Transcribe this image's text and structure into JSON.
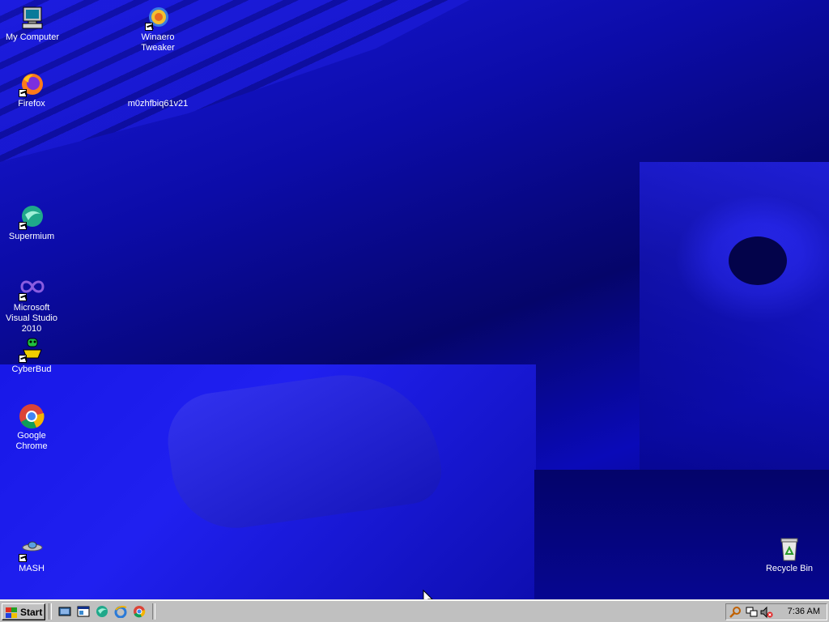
{
  "desktop": {
    "icons": [
      {
        "label": "My Computer"
      },
      {
        "label": "Winaero Tweaker"
      },
      {
        "label": "Firefox"
      },
      {
        "label": "m0zhfbiq61v21"
      },
      {
        "label": "Supermium"
      },
      {
        "label": "Microsoft Visual Studio 2010"
      },
      {
        "label": "CyberBud"
      },
      {
        "label": "Google Chrome"
      },
      {
        "label": "MASH"
      },
      {
        "label": "Recycle Bin"
      }
    ]
  },
  "taskbar": {
    "start_label": "Start",
    "quick_launch": [
      "show-desktop-icon",
      "explorer-icon",
      "supermium-icon",
      "internet-explorer-icon",
      "chrome-icon"
    ],
    "tray_icons": [
      "search-icon",
      "network-icon",
      "volume-muted-icon"
    ],
    "clock": "7:36 AM"
  },
  "colors": {
    "taskbar": "#c0c0c0",
    "wallpaper": "#0a0a90"
  }
}
